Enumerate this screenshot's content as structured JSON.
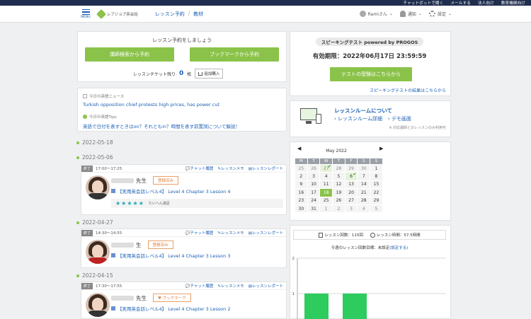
{
  "topbar": {
    "links": [
      "チャットボットで聞く",
      "メールする",
      "法人向け",
      "教育機関向け"
    ]
  },
  "header": {
    "menu_label": "MENU",
    "logo_text": "レアジョブ英会話",
    "breadcrumbs": [
      "レッスン予約",
      "教材"
    ],
    "user": "Ramiさん",
    "notify": "通知",
    "settings": "設定"
  },
  "booking": {
    "title": "レッスン予約をしましょう",
    "btn_search": "講師検索から予約",
    "btn_bookmark": "ブックマークから予約",
    "ticket_label": "レッスンチケット残り",
    "ticket_count": "0",
    "ticket_unit": "枚",
    "add_label": "追加購入"
  },
  "news": {
    "news_label": "今日の英語ニュース",
    "news_title": "Turkish opposition chief protests high prices, has power cut",
    "tips_label": "今日の英語Tips",
    "tips_title": "英語で日付を表すときはon？それともin？時間を表す前置詞について解説！"
  },
  "timeline": {
    "dates": [
      "2022-05-18",
      "2022-05-06",
      "2022-04-27",
      "2022-04-15"
    ],
    "lessons": [
      {
        "status": "終了",
        "time": "17:00～17:25",
        "teacher_suffix": "先生",
        "badge": "登録済み",
        "course": "【実用英会話レベル4】 Level 4 Chapter 3 Lesson 4",
        "stars": "★★★★★",
        "review": "たいへん満足"
      },
      {
        "status": "終了",
        "time": "14:30～14:55",
        "teacher_suffix": "生",
        "badge": "登録済み",
        "course": "【実用英会話レベル4】 Level 4 Chapter 3 Lesson 3"
      },
      {
        "status": "終了",
        "time": "17:30～17:55",
        "teacher_suffix": "先生",
        "badge": "♥ ブックマーク",
        "course": "【実用英会話レベル4】 Level 4 Chapter 3 Lesson 2"
      }
    ],
    "actions": [
      "チャット履歴",
      "レッスンメモ",
      "レッスンレポート"
    ]
  },
  "speaking": {
    "title": "スピーキングテスト powered by PROGOS",
    "expiry": "有効期限：2022年06月17日 23:59:59",
    "btn": "テストの受験はこちらから",
    "result_link": "スピーキングテストの結果はこちらから"
  },
  "room": {
    "title": "レッスンルームについて",
    "link_detail": "レッスンルーム詳細",
    "link_demo": "デモ画面",
    "note": "※ 対応議師とのレッスンのみ利用可"
  },
  "calendar": {
    "month": "May 2022",
    "days": [
      "M",
      "T",
      "W",
      "T",
      "F",
      "S",
      "S"
    ],
    "weeks": [
      [
        "25",
        "26",
        "27",
        "28",
        "29",
        "30",
        "1"
      ],
      [
        "2",
        "3",
        "4",
        "5",
        "6",
        "7",
        "8"
      ],
      [
        "9",
        "10",
        "11",
        "12",
        "13",
        "14",
        "15"
      ],
      [
        "16",
        "17",
        "18",
        "19",
        "20",
        "21",
        "22"
      ],
      [
        "23",
        "24",
        "25",
        "26",
        "27",
        "28",
        "29"
      ],
      [
        "30",
        "31",
        "1",
        "2",
        "3",
        "4",
        "5"
      ]
    ]
  },
  "stats": {
    "count_label": "レッスン回数：115回",
    "time_label": "レッスン時間：57.5時間",
    "goal_prefix": "今週のレッスン回数目標：",
    "goal_status": "未設定",
    "goal_link": "(設定する)"
  },
  "chart_data": {
    "type": "bar",
    "title": "",
    "ylim": [
      0,
      2
    ],
    "yticks": [
      "2",
      "1"
    ],
    "values": [
      1,
      1
    ]
  },
  "colors": {
    "accent_green": "#8bc34a",
    "link_blue": "#1a5fb4",
    "bar_green": "#2ecc5f",
    "nav_dark": "#1f2d4e"
  }
}
